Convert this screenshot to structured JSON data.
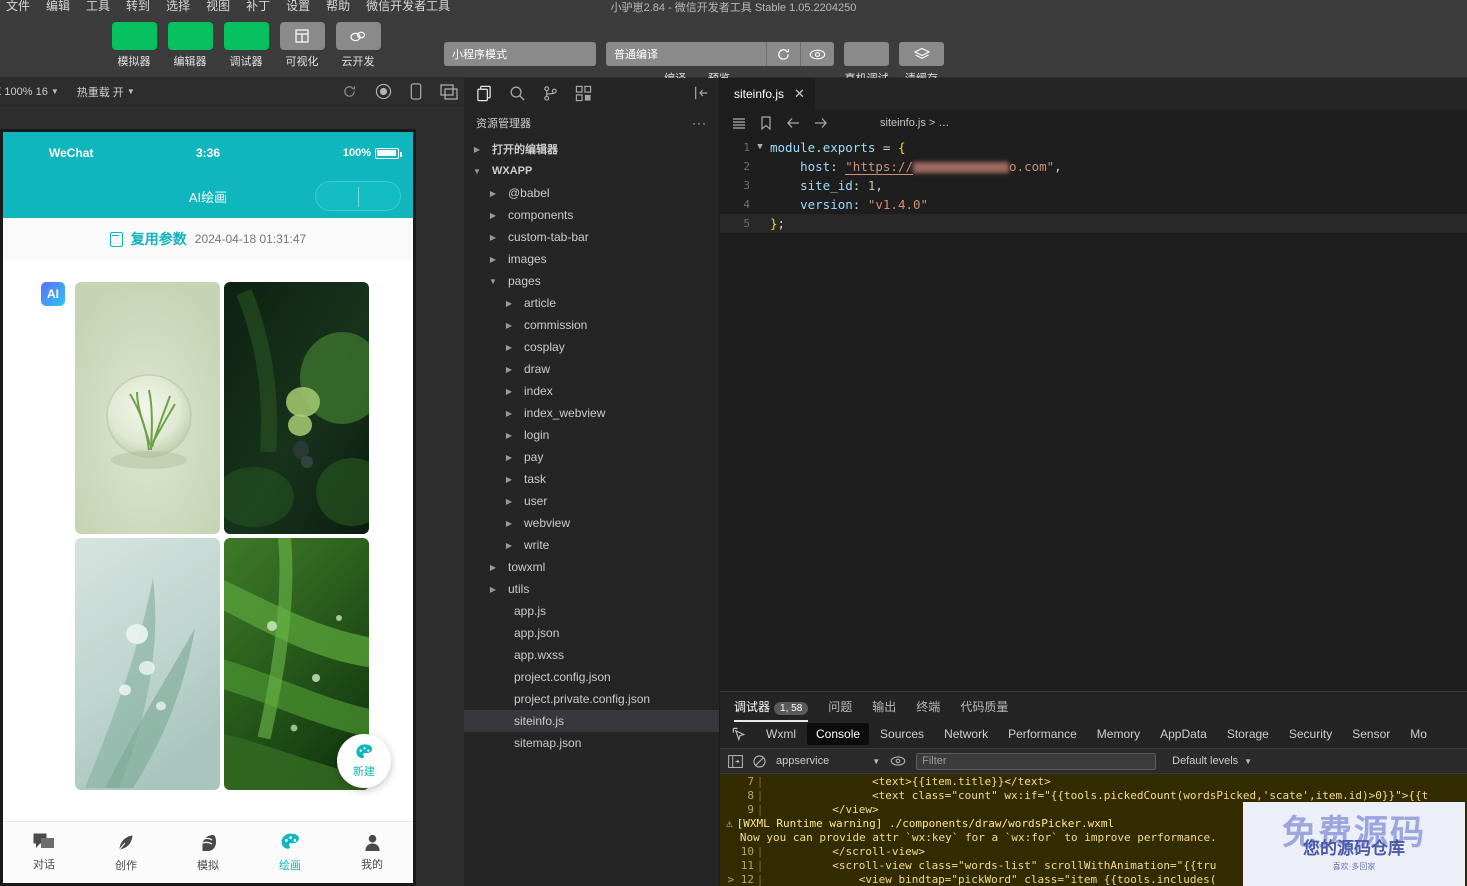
{
  "window": {
    "title": "小驴崽2.84 - 微信开发者工具 Stable 1.05.2204250",
    "menus": [
      "文件",
      "编辑",
      "工具",
      "转到",
      "选择",
      "视图",
      "补丁",
      "设置",
      "帮助",
      "微信开发者工具"
    ]
  },
  "toolbar": {
    "items": [
      {
        "label": "模拟器",
        "icon": "simulator-icon",
        "style": "green"
      },
      {
        "label": "编辑器",
        "icon": "editor-icon",
        "style": "green"
      },
      {
        "label": "调试器",
        "icon": "debugger-icon",
        "style": "green"
      },
      {
        "label": "可视化",
        "icon": "visual-icon",
        "style": "grey"
      },
      {
        "label": "云开发",
        "icon": "cloud-icon",
        "style": "grey"
      }
    ],
    "mode_select": "小程序模式",
    "compile_select": "普通编译",
    "refresh_icon": "refresh-icon",
    "eye_icon": "eye-icon",
    "clear_cache_icon": "layers-icon",
    "sub_labels": {
      "compile": "编译",
      "preview": "预览",
      "real_device": "真机调试",
      "clear_cache": "清缓存"
    }
  },
  "sim_toolbar": {
    "zoom": "X 100% 16",
    "hot_reload": "热重载 开",
    "icons": [
      "refresh-icon",
      "record-icon",
      "phone-icon",
      "multi-window-icon"
    ]
  },
  "simulator": {
    "status_bar": {
      "carrier": "WeChat",
      "time": "3:36",
      "battery": "100%"
    },
    "nav_title": "AI绘画",
    "reuse": {
      "label": "复用参数",
      "time": "2024-04-18 01:31:47",
      "icon": "copy-icon"
    },
    "avatar_text": "AI",
    "fab": {
      "label": "新建",
      "icon": "palette-icon"
    },
    "images": [
      {
        "name": "water-drop-on-sage",
        "bg_top": "#d5dfc5",
        "bg_bottom": "#c9d6b8"
      },
      {
        "name": "dew-on-dark-leaf",
        "bg_top": "#14301a",
        "bg_bottom": "#0f2415"
      },
      {
        "name": "grass-blade-droplets",
        "bg_top": "#cfe0dc",
        "bg_bottom": "#b9d2cc"
      },
      {
        "name": "wet-green-leaves",
        "bg_top": "#2e5c20",
        "bg_bottom": "#1c3d14"
      }
    ],
    "tabs": [
      {
        "label": "对话",
        "icon": "chat-icon",
        "active": false
      },
      {
        "label": "创作",
        "icon": "feather-icon",
        "active": false
      },
      {
        "label": "模拟",
        "icon": "mask-icon",
        "active": false
      },
      {
        "label": "绘画",
        "icon": "palette-icon",
        "active": true
      },
      {
        "label": "我的",
        "icon": "person-icon",
        "active": false
      }
    ]
  },
  "explorer": {
    "activity_icons": [
      "files-icon",
      "search-icon",
      "source-control-icon",
      "extensions-icon",
      "collapse-icon"
    ],
    "title": "资源管理器",
    "more_icon": "ellipsis-icon",
    "tree": [
      {
        "label": "打开的编辑器",
        "depth": 0,
        "arrow": "right",
        "section": true,
        "type": "section"
      },
      {
        "label": "WXAPP",
        "depth": 0,
        "arrow": "down",
        "section": true,
        "type": "section"
      },
      {
        "label": "@babel",
        "depth": 1,
        "arrow": "right",
        "type": "folder"
      },
      {
        "label": "components",
        "depth": 1,
        "arrow": "right",
        "type": "folder"
      },
      {
        "label": "custom-tab-bar",
        "depth": 1,
        "arrow": "right",
        "type": "folder"
      },
      {
        "label": "images",
        "depth": 1,
        "arrow": "right",
        "type": "folder"
      },
      {
        "label": "pages",
        "depth": 1,
        "arrow": "down",
        "type": "folder"
      },
      {
        "label": "article",
        "depth": 2,
        "arrow": "right",
        "type": "folder"
      },
      {
        "label": "commission",
        "depth": 2,
        "arrow": "right",
        "type": "folder"
      },
      {
        "label": "cosplay",
        "depth": 2,
        "arrow": "right",
        "type": "folder"
      },
      {
        "label": "draw",
        "depth": 2,
        "arrow": "right",
        "type": "folder"
      },
      {
        "label": "index",
        "depth": 2,
        "arrow": "right",
        "type": "folder"
      },
      {
        "label": "index_webview",
        "depth": 2,
        "arrow": "right",
        "type": "folder"
      },
      {
        "label": "login",
        "depth": 2,
        "arrow": "right",
        "type": "folder"
      },
      {
        "label": "pay",
        "depth": 2,
        "arrow": "right",
        "type": "folder"
      },
      {
        "label": "task",
        "depth": 2,
        "arrow": "right",
        "type": "folder"
      },
      {
        "label": "user",
        "depth": 2,
        "arrow": "right",
        "type": "folder"
      },
      {
        "label": "webview",
        "depth": 2,
        "arrow": "right",
        "type": "folder"
      },
      {
        "label": "write",
        "depth": 2,
        "arrow": "right",
        "type": "folder"
      },
      {
        "label": "towxml",
        "depth": 1,
        "arrow": "right",
        "type": "folder"
      },
      {
        "label": "utils",
        "depth": 1,
        "arrow": "right",
        "type": "folder"
      },
      {
        "label": "app.js",
        "depth": 1,
        "arrow": "none",
        "type": "file"
      },
      {
        "label": "app.json",
        "depth": 1,
        "arrow": "none",
        "type": "file"
      },
      {
        "label": "app.wxss",
        "depth": 1,
        "arrow": "none",
        "type": "file"
      },
      {
        "label": "project.config.json",
        "depth": 1,
        "arrow": "none",
        "type": "file"
      },
      {
        "label": "project.private.config.json",
        "depth": 1,
        "arrow": "none",
        "type": "file"
      },
      {
        "label": "siteinfo.js",
        "depth": 1,
        "arrow": "none",
        "type": "file",
        "selected": true
      },
      {
        "label": "sitemap.json",
        "depth": 1,
        "arrow": "none",
        "type": "file"
      }
    ]
  },
  "editor": {
    "tab_label": "siteinfo.js",
    "close_icon": "close-icon",
    "breadcrumb_icons": [
      "outline-icon",
      "bookmark-icon",
      "back-arrow-icon",
      "forward-arrow-icon"
    ],
    "breadcrumb_path": "siteinfo.js",
    "breadcrumb_more": "…",
    "lines": [
      {
        "n": "1",
        "fold": "v",
        "parts": [
          {
            "t": "module",
            "c": "tok-var"
          },
          {
            "t": ".",
            "c": "tok-op"
          },
          {
            "t": "exports",
            "c": "tok-prop"
          },
          {
            "t": " = ",
            "c": "tok-op"
          },
          {
            "t": "{",
            "c": "tok-brace"
          }
        ]
      },
      {
        "n": "2",
        "fold": "",
        "indent": 4,
        "parts": [
          {
            "t": "host",
            "c": "tok-prop"
          },
          {
            "t": ": ",
            "c": "tok-op"
          },
          {
            "t": "\"https://",
            "c": "tok-str"
          },
          {
            "t": "REDACT",
            "c": "redact"
          },
          {
            "t": "o.com\"",
            "c": "tok-str"
          },
          {
            "t": ",",
            "c": "tok-op"
          }
        ]
      },
      {
        "n": "3",
        "fold": "",
        "indent": 4,
        "parts": [
          {
            "t": "site_id",
            "c": "tok-prop"
          },
          {
            "t": ": ",
            "c": "tok-op"
          },
          {
            "t": "1",
            "c": "tok-num"
          },
          {
            "t": ",",
            "c": "tok-op"
          }
        ]
      },
      {
        "n": "4",
        "fold": "",
        "indent": 4,
        "parts": [
          {
            "t": "version",
            "c": "tok-prop"
          },
          {
            "t": ": ",
            "c": "tok-op"
          },
          {
            "t": "\"v1.4.0\"",
            "c": "tok-str"
          }
        ]
      },
      {
        "n": "5",
        "fold": "",
        "cur": true,
        "parts": [
          {
            "t": "}",
            "c": "tok-brace"
          },
          {
            "t": ";",
            "c": "tok-op"
          }
        ]
      }
    ]
  },
  "devtools": {
    "top_tabs": [
      {
        "label": "调试器",
        "badge": "1, 58",
        "active": true
      },
      {
        "label": "问题",
        "active": false
      },
      {
        "label": "输出",
        "active": false
      },
      {
        "label": "终端",
        "active": false
      },
      {
        "label": "代码质量",
        "active": false
      }
    ],
    "inspect_icon": "inspect-icon",
    "panels": [
      {
        "label": "Wxml",
        "active": false
      },
      {
        "label": "Console",
        "active": true
      },
      {
        "label": "Sources",
        "active": false
      },
      {
        "label": "Network",
        "active": false
      },
      {
        "label": "Performance",
        "active": false
      },
      {
        "label": "Memory",
        "active": false
      },
      {
        "label": "AppData",
        "active": false
      },
      {
        "label": "Storage",
        "active": false
      },
      {
        "label": "Security",
        "active": false
      },
      {
        "label": "Sensor",
        "active": false
      },
      {
        "label": "Mo",
        "active": false
      }
    ],
    "filterbar": {
      "sidebar_icon": "sidebar-icon",
      "clear_icon": "clear-console-icon",
      "context": "appservice",
      "eye_icon": "eye-icon",
      "filter_placeholder": "Filter",
      "levels": "Default levels"
    },
    "console": [
      {
        "type": "code",
        "num": "7",
        "text": "                <text>{{item.title}}</text>"
      },
      {
        "type": "code",
        "num": "8",
        "text": "                <text class=\"count\" wx:if=\"{{tools.pickedCount(wordsPicked,'scate',item.id)>0}}\">{{t"
      },
      {
        "type": "code",
        "num": "9",
        "text": "          </view>"
      },
      {
        "type": "warning",
        "title": "[WXML Runtime warning] ./components/draw/wordsPicker.wxml",
        "detail": "Now you can provide attr `wx:key` for a `wx:for` to improve performance."
      },
      {
        "type": "code",
        "num": "10",
        "text": "          </scroll-view>"
      },
      {
        "type": "code",
        "num": "11",
        "text": "          <scroll-view class=\"words-list\" scrollWithAnimation=\"{{tru"
      },
      {
        "type": "code",
        "num": "12",
        "expand": true,
        "text": "              <view bindtap=\"pickWord\" class=\"item {{tools.includes("
      }
    ]
  },
  "watermark": {
    "big": "免费源码",
    "mid": "您的源码仓库",
    "small": "喜欢·多回家"
  },
  "colors": {
    "accent": "#07c160",
    "brand_teal": "#0fb6bd",
    "toolbar_bg": "#3c3c3c",
    "editor_bg": "#1e1e1e",
    "explorer_bg": "#252526"
  }
}
